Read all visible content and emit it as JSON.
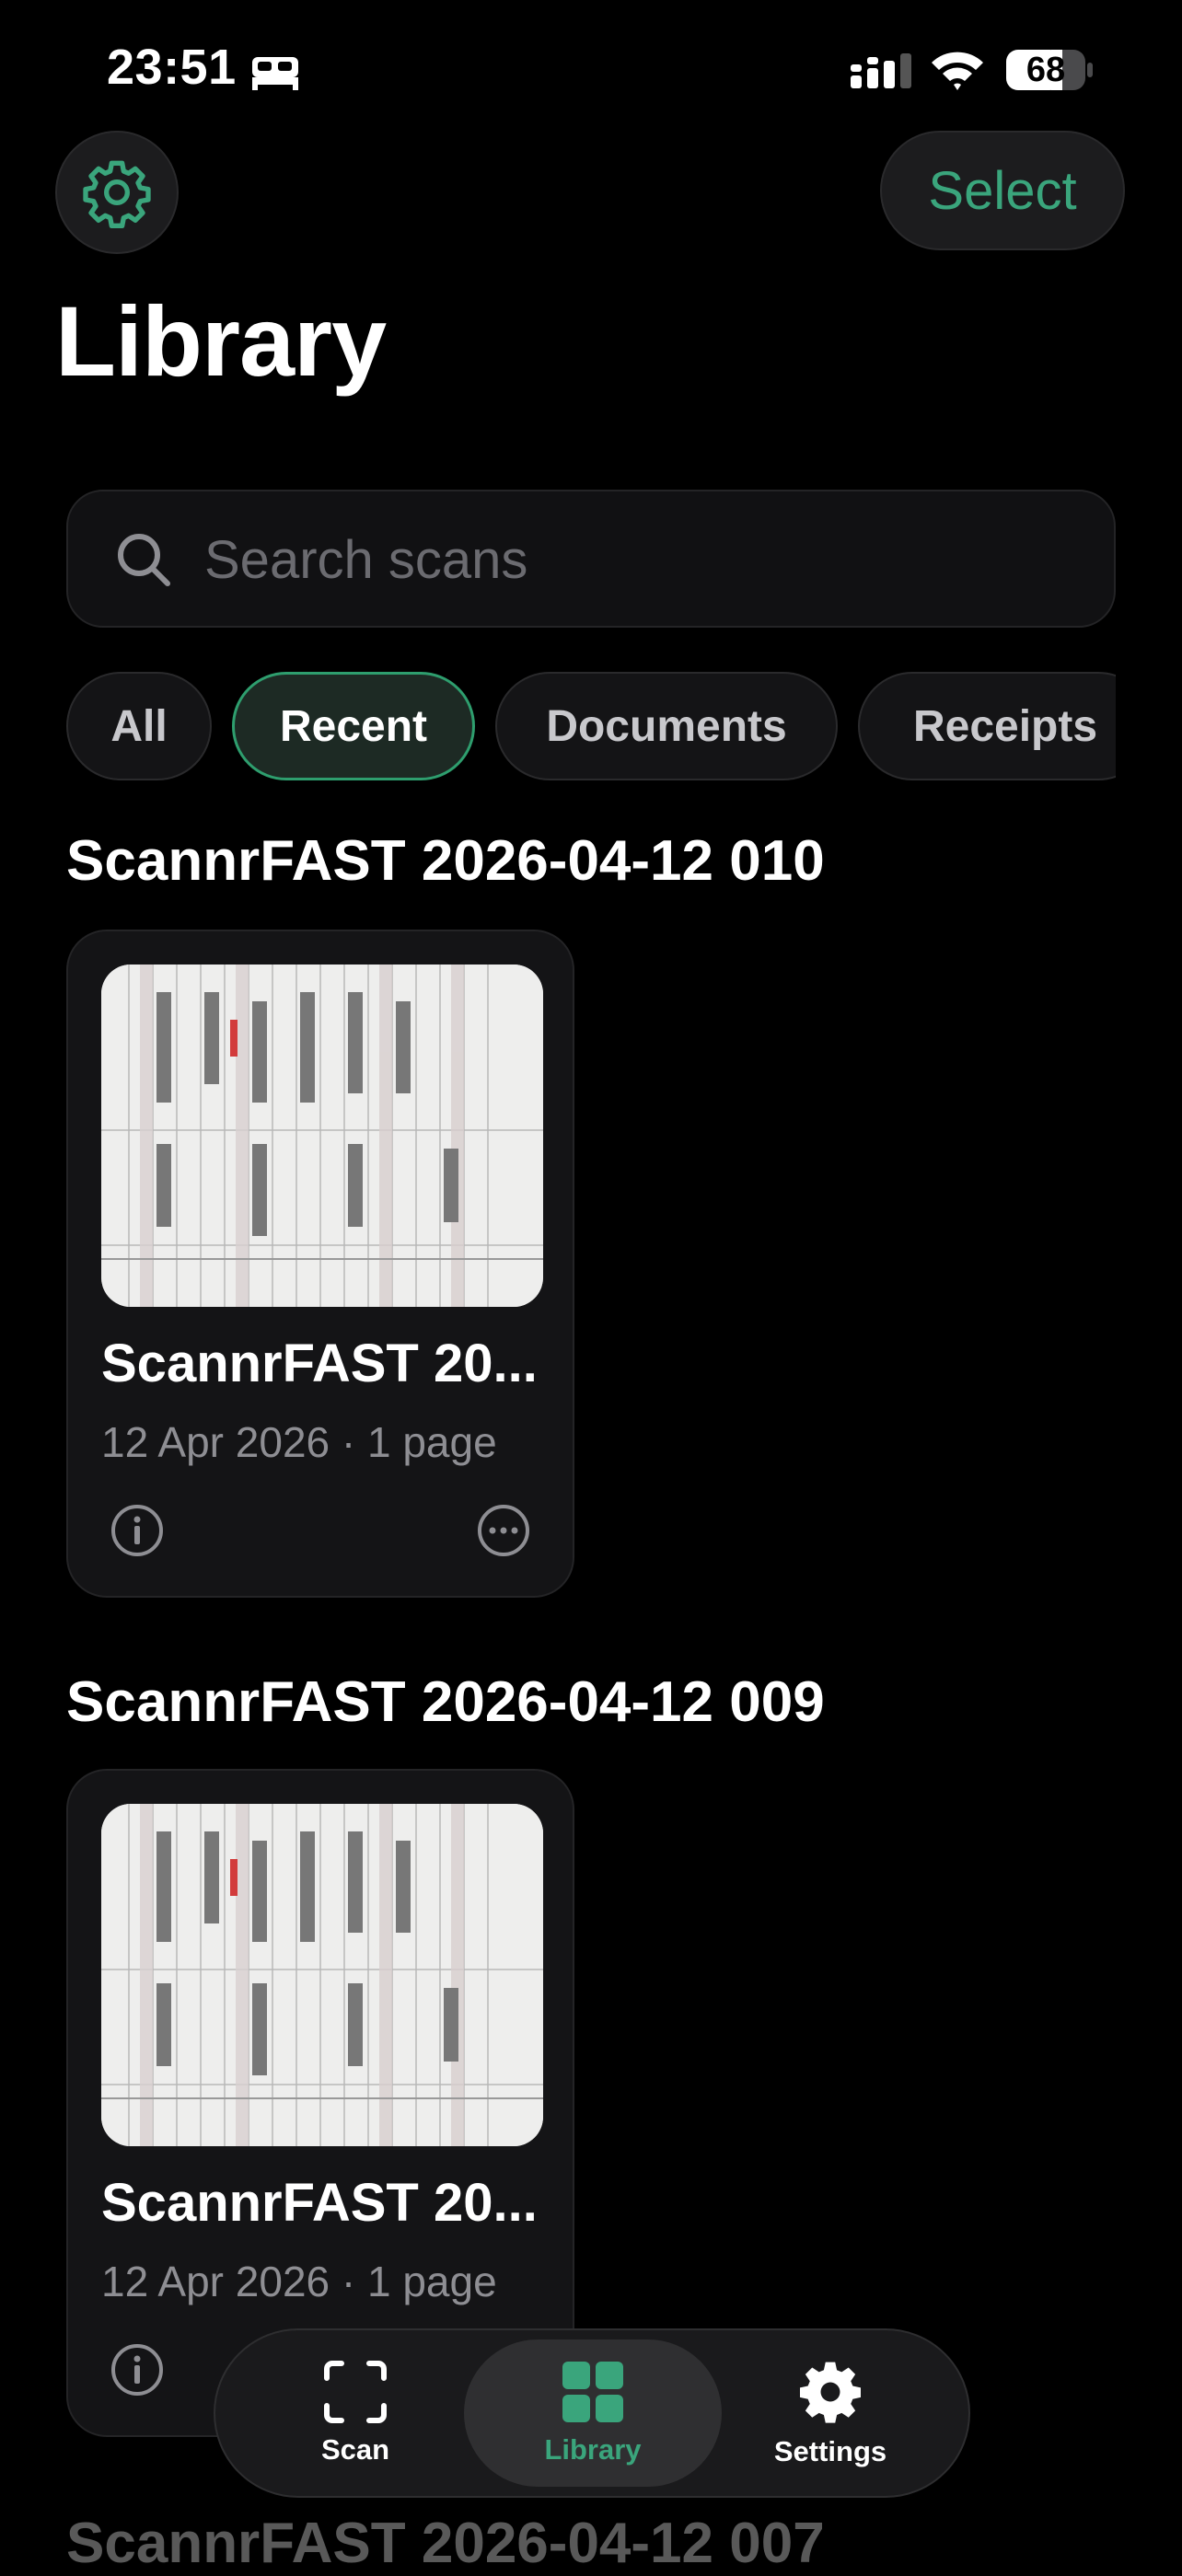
{
  "status_bar": {
    "time": "23:51",
    "battery": "68"
  },
  "header": {
    "select_label": "Select",
    "title": "Library"
  },
  "search": {
    "placeholder": "Search scans",
    "value": ""
  },
  "filters": [
    {
      "label": "All",
      "active": false
    },
    {
      "label": "Recent",
      "active": true
    },
    {
      "label": "Documents",
      "active": false
    },
    {
      "label": "Receipts",
      "active": false
    }
  ],
  "sections": [
    {
      "title": "ScannrFAST 2026-04-12 010",
      "card": {
        "name": "ScannrFAST 20...",
        "meta": "12 Apr 2026 · 1 page"
      }
    },
    {
      "title": "ScannrFAST 2026-04-12 009",
      "card": {
        "name": "ScannrFAST 20...",
        "meta": "12 Apr 2026 · 1 page"
      }
    },
    {
      "title": "ScannrFAST 2026-04-12 007"
    }
  ],
  "tabbar": {
    "tabs": [
      {
        "label": "Scan",
        "icon": "scan-icon",
        "active": false
      },
      {
        "label": "Library",
        "icon": "grid-icon",
        "active": true
      },
      {
        "label": "Settings",
        "icon": "gear-icon",
        "active": false
      }
    ]
  },
  "colors": {
    "accent": "#3aa57c",
    "background": "#000000",
    "card": "#141416"
  }
}
